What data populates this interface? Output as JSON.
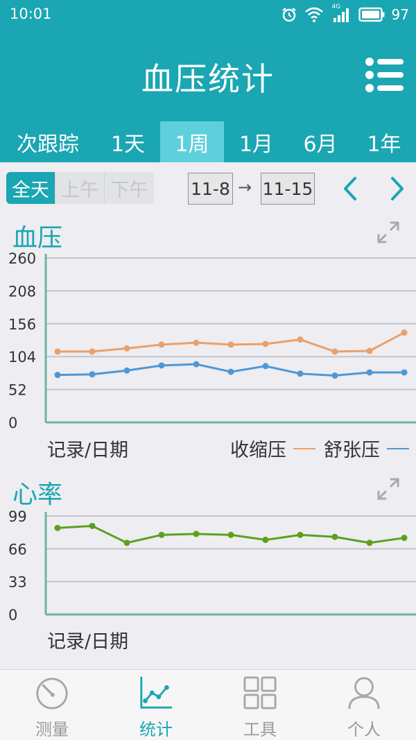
{
  "status": {
    "time": "10:01",
    "battery": "97",
    "network": "4G"
  },
  "header": {
    "title": "血压统计"
  },
  "tabs": [
    {
      "label": "次跟踪",
      "active": false
    },
    {
      "label": "1天",
      "active": false
    },
    {
      "label": "1周",
      "active": true
    },
    {
      "label": "1月",
      "active": false
    },
    {
      "label": "6月",
      "active": false
    },
    {
      "label": "1年",
      "active": false
    }
  ],
  "segment": [
    {
      "label": "全天",
      "active": true
    },
    {
      "label": "上午",
      "active": false
    },
    {
      "label": "下午",
      "active": false
    }
  ],
  "date_range": {
    "start": "11-8",
    "arrow": "→",
    "end": "11-15"
  },
  "bp_panel": {
    "title": "血压",
    "footer": "记录/日期"
  },
  "hr_panel": {
    "title": "心率",
    "footer": "记录/日期"
  },
  "colors": {
    "primary": "#1aa6b2",
    "tab_active": "#5ed0db",
    "systolic": "#eaa06a",
    "diastolic": "#4d98d6",
    "heart_rate": "#5ba11c",
    "axis": "#6db5a2"
  },
  "chart_data": [
    {
      "type": "line",
      "title": "血压",
      "xlabel": "记录/日期",
      "ylabel": "",
      "ylim": [
        0,
        260
      ],
      "yticks": [
        0,
        52,
        104,
        156,
        208,
        260
      ],
      "grid": true,
      "legend": "bottom-right",
      "x": [
        1,
        2,
        3,
        4,
        5,
        6,
        7,
        8,
        9,
        10,
        11
      ],
      "series": [
        {
          "name": "收缩压",
          "color": "#eaa06a",
          "values": [
            112,
            112,
            117,
            123,
            126,
            123,
            124,
            131,
            112,
            113,
            142
          ]
        },
        {
          "name": "舒张压",
          "color": "#4d98d6",
          "values": [
            75,
            76,
            82,
            90,
            92,
            80,
            89,
            77,
            74,
            79,
            79
          ]
        }
      ]
    },
    {
      "type": "line",
      "title": "心率",
      "xlabel": "记录/日期",
      "ylabel": "",
      "ylim": [
        0,
        99
      ],
      "yticks": [
        0,
        33,
        66,
        99
      ],
      "grid": true,
      "legend": "none",
      "x": [
        1,
        2,
        3,
        4,
        5,
        6,
        7,
        8,
        9,
        10,
        11
      ],
      "series": [
        {
          "color": "#5ba11c",
          "values": [
            87,
            89,
            72,
            80,
            81,
            80,
            75,
            80,
            78,
            72,
            77
          ]
        }
      ]
    }
  ],
  "bottom_nav": [
    {
      "label": "测量",
      "icon": "gauge-icon",
      "active": false
    },
    {
      "label": "统计",
      "icon": "chart-icon",
      "active": true
    },
    {
      "label": "工具",
      "icon": "grid-icon",
      "active": false
    },
    {
      "label": "个人",
      "icon": "person-icon",
      "active": false
    }
  ]
}
